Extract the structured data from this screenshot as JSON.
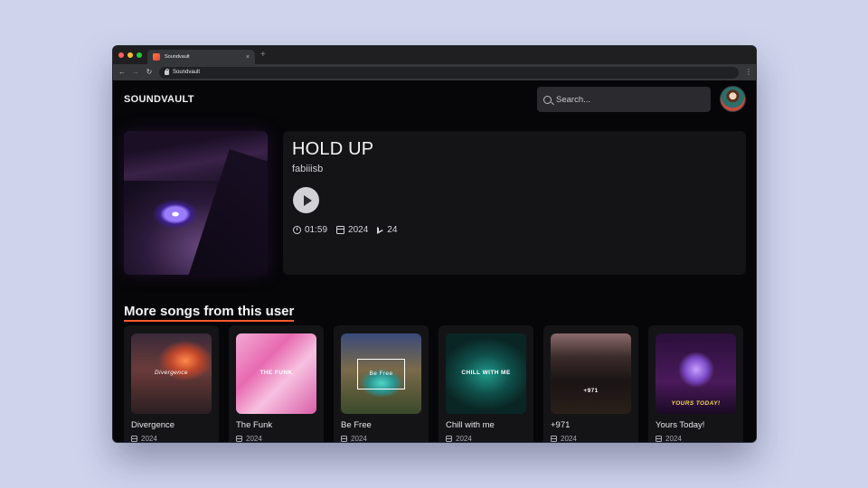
{
  "browser": {
    "tab_title": "Soundvault",
    "tab_close": "×",
    "new_tab": "+",
    "back": "←",
    "forward": "→",
    "reload": "↻",
    "url": "Soundvault",
    "menu": "⋮"
  },
  "header": {
    "logo": "SOUNDVAULT",
    "search_placeholder": "Search..."
  },
  "song": {
    "title": "HOLD UP",
    "artist": "fabiiisb",
    "duration": "01:59",
    "year": "2024",
    "plays": "24"
  },
  "more": {
    "heading": "More songs from this user",
    "cards": [
      {
        "title": "Divergence",
        "year": "2024",
        "art_text": "Divergence"
      },
      {
        "title": "The Funk",
        "year": "2024",
        "art_text": "THE FUNK"
      },
      {
        "title": "Be Free",
        "year": "2024",
        "art_text": "Be Free"
      },
      {
        "title": "Chill with me",
        "year": "2024",
        "art_text": "CHILL WITH ME"
      },
      {
        "title": "+971",
        "year": "2024",
        "art_text": "+971"
      },
      {
        "title": "Yours Today!",
        "year": "2024",
        "art_text": "YOURS TODAY!"
      }
    ]
  },
  "colors": {
    "accent": "#ff5a2c",
    "background": "#060608",
    "surface": "#141417"
  }
}
